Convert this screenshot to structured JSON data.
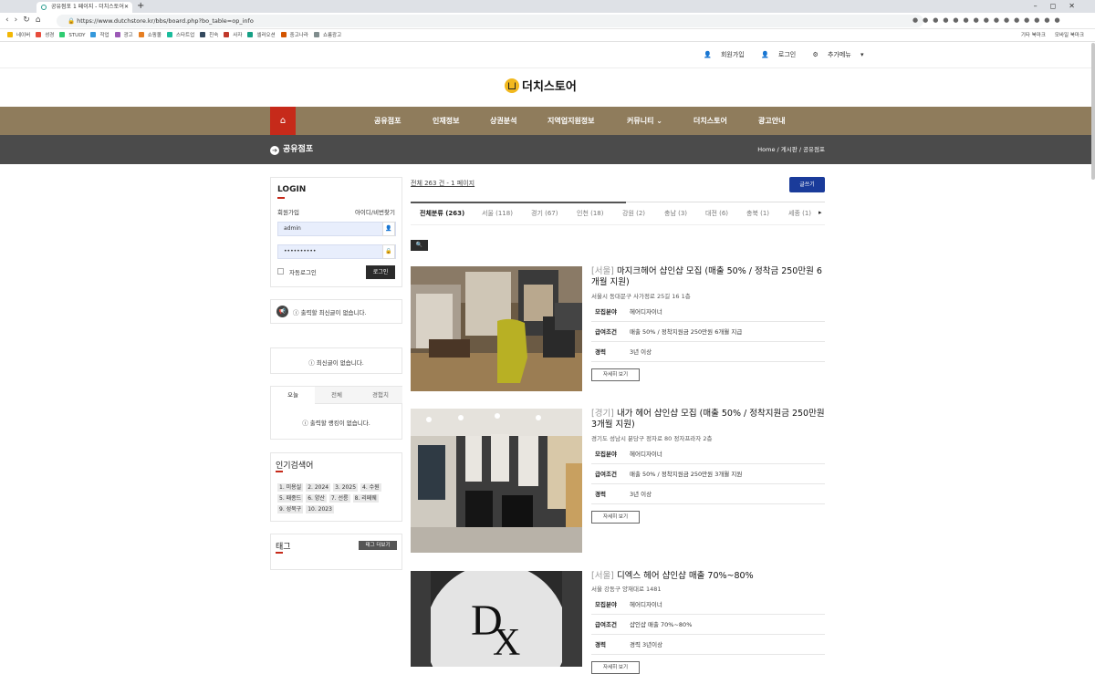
{
  "browser": {
    "tab_title": "공유점포 1 페이지 - 더치스토어",
    "url": "https://www.dutchstore.kr/bbs/board.php?bo_table=op_info",
    "new_tab": "+",
    "bookmarks": [
      "네이버",
      "성경",
      "STUDY",
      "작업",
      "광고",
      "쇼핑몰",
      "스타트업",
      "친숙",
      "사자",
      "셀러오션",
      "중고나라",
      "쇼룸광고"
    ],
    "bookmarks_right": [
      "기타 북마크",
      "모바일 북마크"
    ]
  },
  "topnav": {
    "join": "회원가입",
    "login": "로그인",
    "more": "추가메뉴"
  },
  "logo": {
    "text": "더치스토어"
  },
  "mainnav": {
    "items": [
      "공유점포",
      "인재정보",
      "상권분석",
      "지역업지원정보",
      "커뮤니티",
      "더치스토어",
      "광고안내"
    ]
  },
  "subheader": {
    "title": "공유점포",
    "breadcrumb": [
      "Home",
      "게시판",
      "공유점포"
    ]
  },
  "login": {
    "title": "LOGIN",
    "join": "회원가입",
    "find": "아이디/비번찾기",
    "id_value": "admin",
    "pw_value": "••••••••••",
    "auto": "자동로그인",
    "button": "로그인"
  },
  "notice": {
    "text": "출력할 최신글이 없습니다."
  },
  "recent": {
    "text": "최신글이 없습니다."
  },
  "ranking": {
    "tabs": [
      "오늘",
      "전체",
      "경험치"
    ],
    "text": "출력할 랭킹이 없습니다."
  },
  "popular": {
    "title": "인기검색어",
    "words": [
      "1. 미용실",
      "2. 2024",
      "3. 2025",
      "4. 수원",
      "5. 패종드",
      "6. 양산",
      "7. 선릉",
      "8. 리페웨",
      "9. 성북구",
      "10. 2023"
    ]
  },
  "tags": {
    "title": "태그",
    "more": "태그 더보기"
  },
  "board": {
    "total": "전체 263 건 - 1 페이지",
    "write": "글쓰기",
    "categories": [
      "전체분류 (263)",
      "서울 (118)",
      "경기 (67)",
      "인천 (18)",
      "강원 (2)",
      "충남 (3)",
      "대전 (6)",
      "충북 (1)",
      "세종 (1)"
    ],
    "detail_label": "자세히 보기",
    "posts": [
      {
        "region": "[서울]",
        "title": "마지크헤어 샵인샵 모집 (매출 50% / 정착금 250만원 6개월 지원)",
        "addr": "서울시 동대문구 사가정로 25길 16 1층",
        "rows": [
          {
            "k": "모집분야",
            "v": "헤어디자이너"
          },
          {
            "k": "급여조건",
            "v": "매출 50% / 정착지원금 250만원 6개월 지급"
          },
          {
            "k": "경력",
            "v": "3년 이상"
          }
        ]
      },
      {
        "region": "[경기]",
        "title": "내가 헤어 샵인샵 모집 (매출 50% / 정착지원금 250만원 3개월 지원)",
        "addr": "경기도 성남시 분당구 정자로 80 정자프라자 2층",
        "rows": [
          {
            "k": "모집분야",
            "v": "헤어디자이너"
          },
          {
            "k": "급여조건",
            "v": "매출 50% / 정착지원금 250만원 3개월 지원"
          },
          {
            "k": "경력",
            "v": "3년 이상"
          }
        ]
      },
      {
        "region": "[서울]",
        "title": "디엑스 헤어 샵인샵 매출 70%~80%",
        "addr": "서울 강동구 양재대로 1481",
        "rows": [
          {
            "k": "모집분야",
            "v": "헤어디자이너"
          },
          {
            "k": "급여조건",
            "v": "샵인샵 매출 70%~80%"
          },
          {
            "k": "경력",
            "v": "경력 3년이상"
          }
        ]
      }
    ]
  },
  "colors": {
    "nav": "#8f7c5c",
    "home": "#c62a1a",
    "subheader": "#4b4b4b",
    "write": "#1a3b9a",
    "logo": "#f1b81e"
  }
}
